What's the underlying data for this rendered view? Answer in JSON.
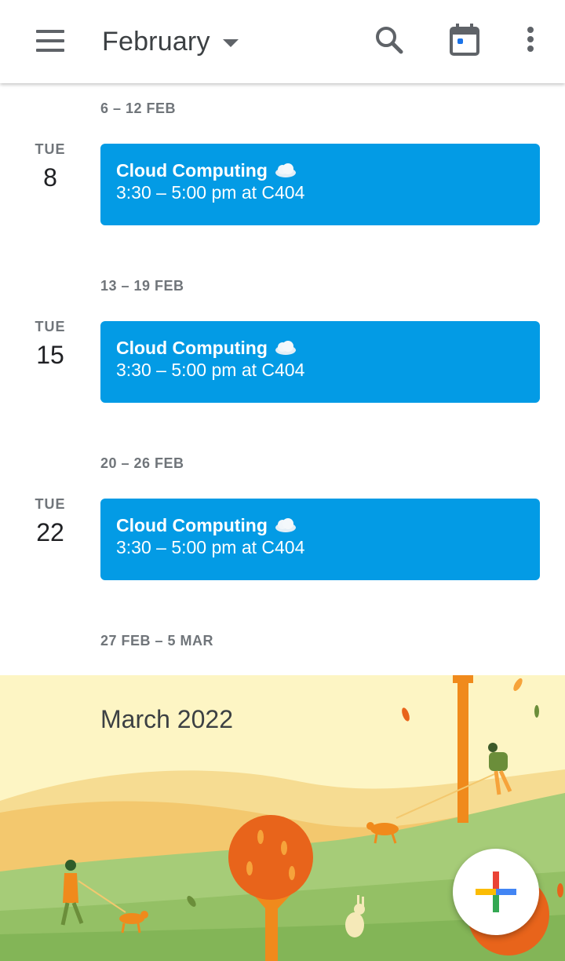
{
  "app_bar": {
    "title": "February",
    "icons": [
      "menu-icon",
      "search-icon",
      "calendar-today-icon",
      "more-vert-icon"
    ]
  },
  "weeks": [
    {
      "range": "6 – 12 FEB",
      "day_abbr": "TUE",
      "day_num": "8",
      "event": {
        "title": "Cloud Computing",
        "emoji": "cloud",
        "details": "3:30 – 5:00 pm at C404"
      }
    },
    {
      "range": "13 – 19 FEB",
      "day_abbr": "TUE",
      "day_num": "15",
      "event": {
        "title": "Cloud Computing",
        "emoji": "cloud",
        "details": "3:30 – 5:00 pm at C404"
      }
    },
    {
      "range": "20 – 26 FEB",
      "day_abbr": "TUE",
      "day_num": "22",
      "event": {
        "title": "Cloud Computing",
        "emoji": "cloud",
        "details": "3:30 – 5:00 pm at C404"
      }
    },
    {
      "range": "27 FEB – 5 MAR"
    }
  ],
  "month_banner": {
    "title": "March 2022"
  },
  "fab": {
    "icon": "create-plus-icon"
  },
  "colors": {
    "event": "#039be5",
    "accent_blue": "#1a73e8",
    "banner_sky": "#fdf5c4",
    "banner_hill": "#a6cc78"
  }
}
